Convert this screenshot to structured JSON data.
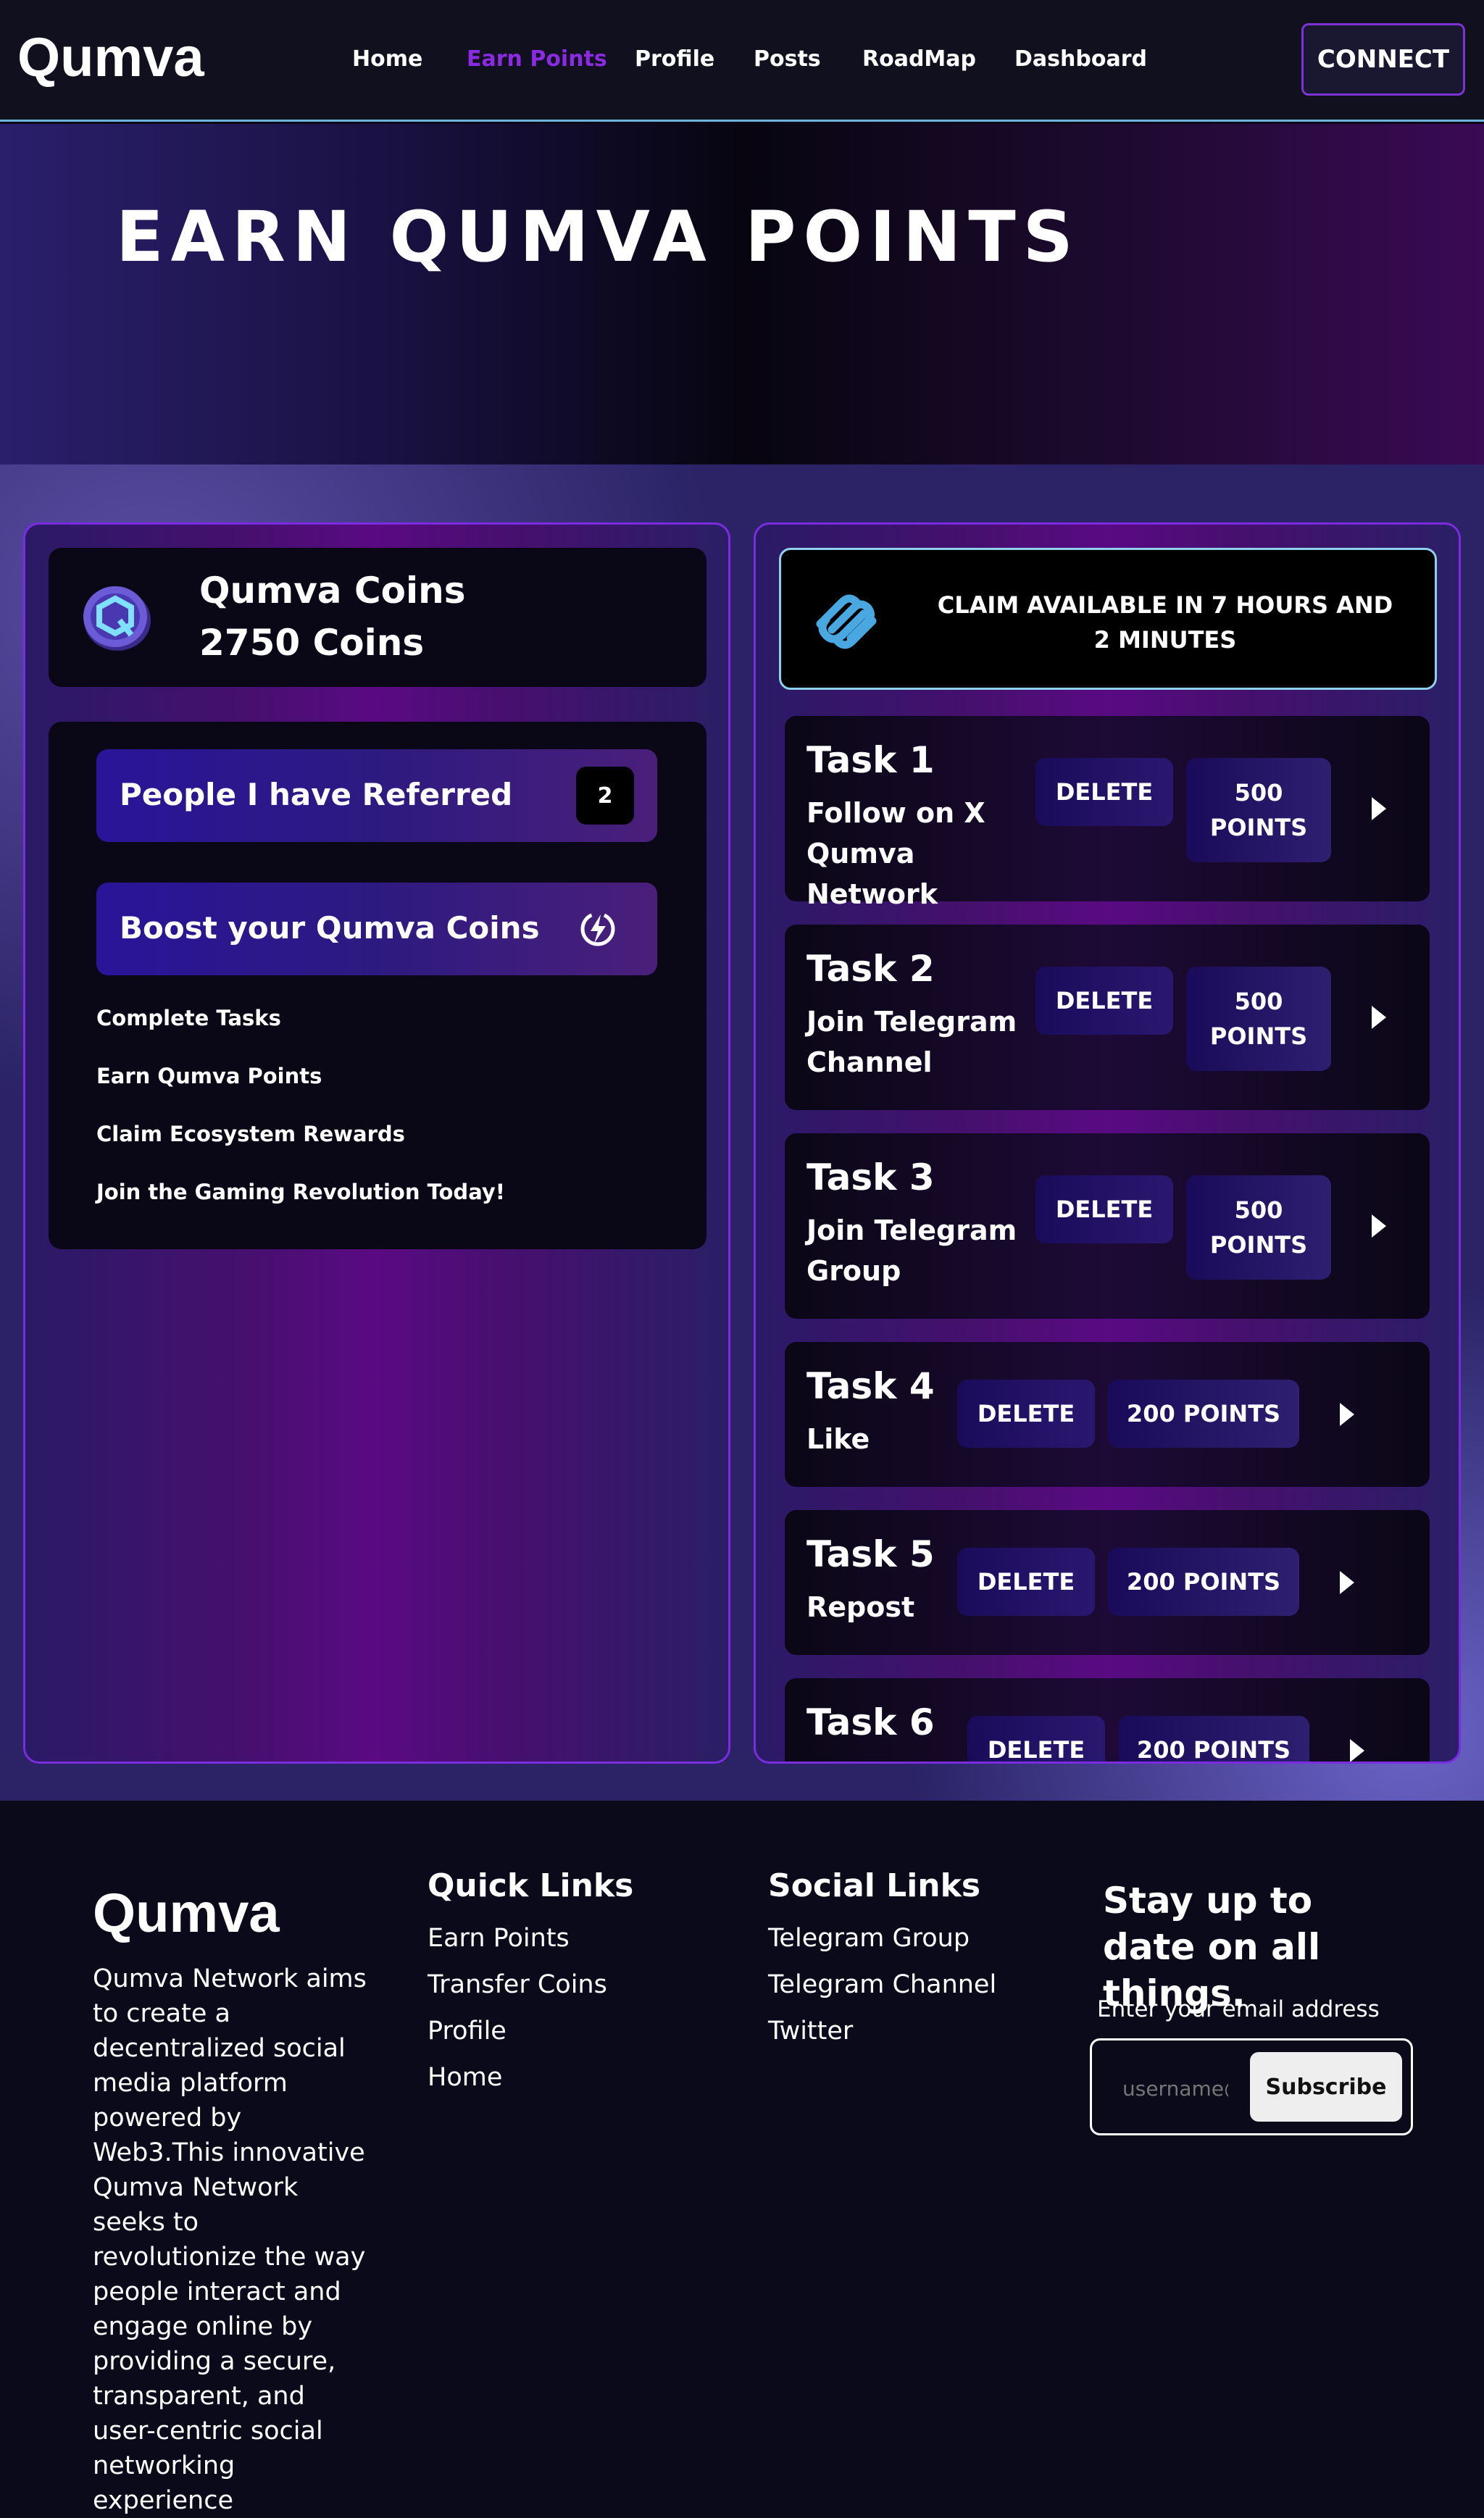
{
  "nav": {
    "brand": "Qumva",
    "links": [
      {
        "label": "Home",
        "active": false
      },
      {
        "label": "Earn Points",
        "active": true
      },
      {
        "label": "Profile",
        "active": false
      },
      {
        "label": "Posts",
        "active": false
      },
      {
        "label": "RoadMap",
        "active": false
      },
      {
        "label": "Dashboard",
        "active": false
      }
    ],
    "connect_label": "CONNECT"
  },
  "hero": {
    "title": "EARN QUMVA POINTS"
  },
  "coins": {
    "title": "Qumva Coins",
    "amount": "2750 Coins",
    "icon": "qumva-coin-icon"
  },
  "referrals": {
    "label": "People I have Referred",
    "count": "2"
  },
  "boost": {
    "label": "Boost your Qumva Coins",
    "icon": "bolt-icon"
  },
  "info_items": [
    "Complete Tasks",
    "Earn Qumva Points",
    "Claim Ecosystem Rewards",
    "Join the Gaming Revolution Today!"
  ],
  "claim": {
    "text": "CLAIM AVAILABLE IN 7 HOURS AND 2 MINUTES",
    "icon": "squarespace-icon"
  },
  "tasks": [
    {
      "title": "Task 1",
      "subtitle": "Follow on X Qumva Network",
      "delete_label": "DELETE",
      "points_label": "500 POINTS"
    },
    {
      "title": "Task 2",
      "subtitle": "Join Telegram Channel",
      "delete_label": "DELETE",
      "points_label": "500 POINTS"
    },
    {
      "title": "Task 3",
      "subtitle": "Join Telegram Group",
      "delete_label": "DELETE",
      "points_label": "500 POINTS"
    },
    {
      "title": "Task 4",
      "subtitle": "Like",
      "delete_label": "DELETE",
      "points_label": "200 POINTS"
    },
    {
      "title": "Task 5",
      "subtitle": "Repost",
      "delete_label": "DELETE",
      "points_label": "200 POINTS"
    },
    {
      "title": "Task 6",
      "subtitle": "",
      "delete_label": "DELETE",
      "points_label": "200 POINTS"
    }
  ],
  "footer": {
    "brand": "Qumva",
    "description": "Qumva Network aims to create a decentralized social media platform powered by Web3.This innovative Qumva Network seeks to revolutionize the way people interact and engage online by providing a secure, transparent, and user-centric social networking experience",
    "quick_links_heading": "Quick Links",
    "quick_links": [
      "Earn Points",
      "Transfer Coins",
      "Profile",
      "Home"
    ],
    "social_links_heading": "Social Links",
    "social_links": [
      "Telegram Group",
      "Telegram Channel",
      "Twitter"
    ],
    "newsletter_heading": "Stay up to date on all things.",
    "email_label": "Enter your email address",
    "email_placeholder": "username@",
    "subscribe_label": "Subscribe"
  },
  "colors": {
    "accent": "#8a2be2",
    "nav_bg": "#11101f",
    "claim_border": "#8fd0ea",
    "claim_icon": "#4aa8e0"
  }
}
